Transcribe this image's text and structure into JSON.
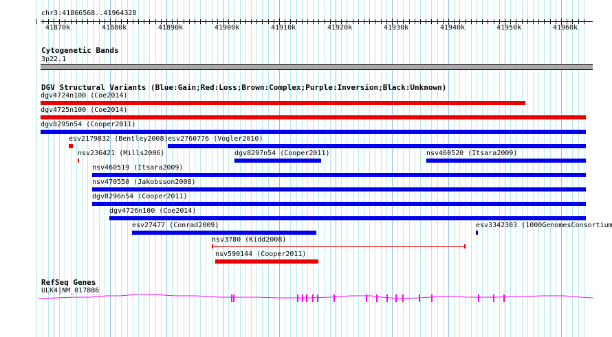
{
  "ruler": {
    "location": "chr3:41866568..41964328",
    "ticks": [
      "41870k",
      "41880k",
      "41890k",
      "41900k",
      "41910k",
      "41920k",
      "41930k",
      "41940k",
      "41950k",
      "41960k"
    ]
  },
  "cytobands": {
    "title": "Cytogenetic Bands",
    "band": "3p22.1"
  },
  "dgv": {
    "title": "DGV Structural Variants (Blue:Gain;Red:Loss;Brown:Complex;Purple:Inversion;Black:Unknown)",
    "colors": {
      "gain": "#0000ee",
      "loss": "#ee0000"
    },
    "features": [
      {
        "label": "dgv4724n100 (Coe2014)",
        "type": "loss",
        "start_kb": 41865.8,
        "end_kb": 41953.6,
        "row": 0
      },
      {
        "label": "dgv4725n100 (Coe2014)",
        "type": "loss",
        "start_kb": 41865.8,
        "end_kb": 41964.4,
        "row": 1
      },
      {
        "label": "dgv8295n54 (Cooper2011)",
        "type": "gain",
        "start_kb": 41865.8,
        "end_kb": 41964.4,
        "row": 2
      },
      {
        "label": "esv2179832 (Bentley2008)",
        "type": "loss",
        "start_kb": 41872.7,
        "end_kb": 41873.4,
        "row": 3
      },
      {
        "label": "esv2760776 (Vogler2010)",
        "type": "gain",
        "start_kb": 41890.2,
        "end_kb": 41964.4,
        "row": 3
      },
      {
        "label": "nsv236421 (Mills2006)",
        "type": "loss",
        "start_kb": 41874.3,
        "end_kb": 41874.5,
        "row": 4
      },
      {
        "label": "dgv8297n54 (Cooper2011)",
        "type": "gain",
        "start_kb": 41902.1,
        "end_kb": 41917.4,
        "row": 4
      },
      {
        "label": "nsv460520 (Itsara2009)",
        "type": "gain",
        "start_kb": 41936.1,
        "end_kb": 41964.4,
        "row": 4
      },
      {
        "label": "nsv460519 (Itsara2009)",
        "type": "gain",
        "start_kb": 41876.8,
        "end_kb": 41964.4,
        "row": 5
      },
      {
        "label": "nsv470550 (Jakobsson2008)",
        "type": "gain",
        "start_kb": 41876.8,
        "end_kb": 41964.4,
        "row": 6
      },
      {
        "label": "dgv8296n54 (Cooper2011)",
        "type": "gain",
        "start_kb": 41876.8,
        "end_kb": 41964.4,
        "row": 7
      },
      {
        "label": "dgv4726n100 (Coe2014)",
        "type": "gain",
        "start_kb": 41879.9,
        "end_kb": 41964.4,
        "row": 8
      },
      {
        "label": "esv27477 (Conrad2009)",
        "type": "gain",
        "start_kb": 41883.9,
        "end_kb": 41916.6,
        "row": 9
      },
      {
        "label": "esv3342303 (1000GenomesConsortium",
        "type": "gain",
        "start_kb": 41944.9,
        "end_kb": 41945.2,
        "row": 9
      },
      {
        "label": "nsv3780 (Kidd2008)",
        "type": "loss",
        "start_kb": 41898.1,
        "end_kb": 41943.0,
        "row": 10,
        "thin": true
      },
      {
        "label": "nsv590144 (Cooper2011)",
        "type": "loss",
        "start_kb": 41898.7,
        "end_kb": 41916.9,
        "row": 11
      }
    ]
  },
  "refseq": {
    "title": "RefSeq Genes",
    "gene": "ULK4|NM_017886",
    "color": "#ff00ff"
  }
}
